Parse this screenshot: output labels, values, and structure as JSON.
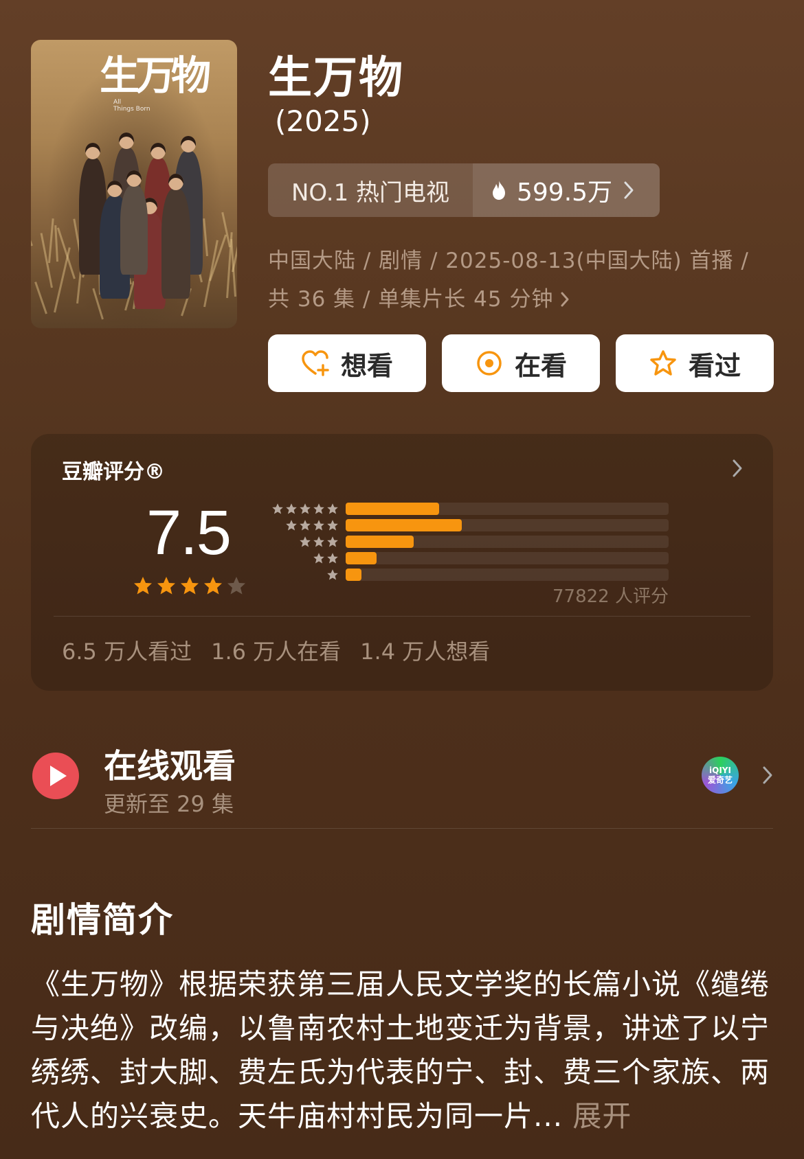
{
  "header": {
    "title": "生万物",
    "year": "(2025)",
    "poster": {
      "title_art": "生万物",
      "subtitle_lines": [
        "All",
        "Things Born"
      ]
    }
  },
  "rank": {
    "label": "NO.1 热门电视",
    "heat": "599.5万"
  },
  "meta": {
    "line1": "中国大陆 / 剧情 / 2025-08-13(中国大陆) 首播 /",
    "line2": "共 36 集 / 单集片长 45 分钟"
  },
  "actions": {
    "want": "想看",
    "watching": "在看",
    "watched": "看过"
  },
  "rating": {
    "label": "豆瓣评分®",
    "score": "7.5",
    "stars_filled": 4,
    "stars_total": 5,
    "count_text": "77822 人评分",
    "distribution": [
      {
        "stars": 5,
        "fraction": 0.29
      },
      {
        "stars": 4,
        "fraction": 0.36
      },
      {
        "stars": 3,
        "fraction": 0.21
      },
      {
        "stars": 2,
        "fraction": 0.095
      },
      {
        "stars": 1,
        "fraction": 0.048
      }
    ],
    "stats": {
      "watched": "6.5 万人看过",
      "watching": "1.6 万人在看",
      "want": "1.4 万人想看"
    }
  },
  "online": {
    "title": "在线观看",
    "update": "更新至 29 集",
    "platform_line1": "iQIYI",
    "platform_line2": "爱奇艺"
  },
  "synopsis": {
    "title": "剧情简介",
    "text": "《生万物》根据荣获第三届人民文学奖的长篇小说《缱绻与决绝》改编，以鲁南农村土地变迁为背景，讲述了以宁绣绣、封大脚、费左氏为代表的宁、封、费三个家族、两代人的兴衰史。天牛庙村村民为同一片...",
    "expand": "展开"
  },
  "colors": {
    "accent_orange": "#f7950f",
    "play_red": "#ea4e55",
    "muted_text": "#a8917e"
  }
}
